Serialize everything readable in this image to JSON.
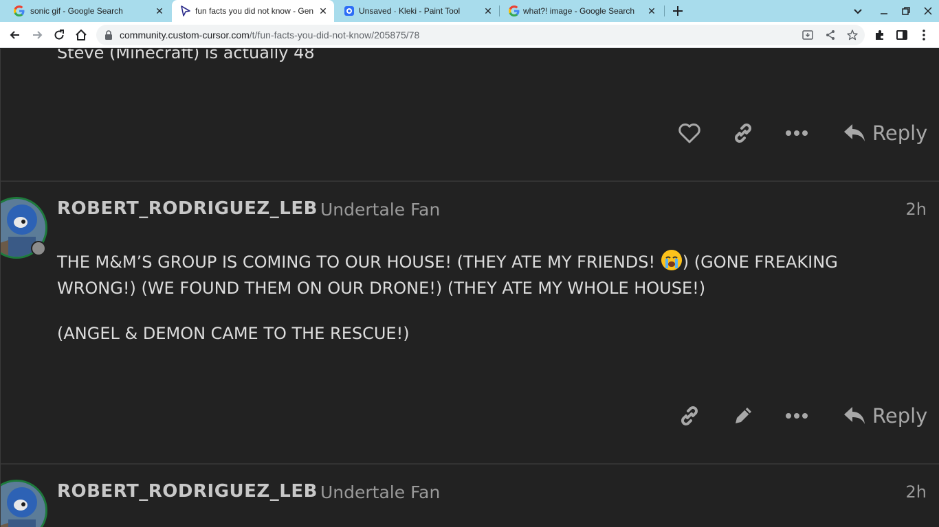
{
  "browser": {
    "tabs": [
      {
        "title": "sonic gif - Google Search",
        "favicon": "google-icon",
        "active": false
      },
      {
        "title": "fun facts you did not know - Gen",
        "favicon": "cursor-icon",
        "active": true
      },
      {
        "title": "Unsaved · Kleki - Paint Tool",
        "favicon": "kleki-icon",
        "active": false
      },
      {
        "title": "what?! image - Google Search",
        "favicon": "google-icon",
        "active": false
      }
    ],
    "url_host": "community.custom-cursor.com",
    "url_path": "/t/fun-facts-you-did-not-know/205875/78"
  },
  "previous_post": {
    "text": "Steve (Minecraft) is actually 48",
    "reply_label": "Reply"
  },
  "posts": [
    {
      "username": "ROBERT_RODRIGUEZ_LEB",
      "user_title": "Undertale Fan",
      "time": "2h",
      "para1_a": "THE M&M’S GROUP IS COMING TO OUR HOUSE! (THEY ATE MY FRIENDS! ",
      "emoji": "loudly-crying-face-emoji",
      "para1_b": ") (GONE FREAKING WRONG!) (WE FOUND THEM ON OUR DRONE!) (THEY ATE MY WHOLE HOUSE!)",
      "para2": "(ANGEL & DEMON CAME TO THE RESCUE!)",
      "reply_label": "Reply"
    },
    {
      "username": "ROBERT_RODRIGUEZ_LEB",
      "user_title": "Undertale Fan",
      "time": "2h"
    }
  ],
  "colors": {
    "tabstrip": "#a8dcec",
    "page_bg": "#222222",
    "avatar_ring": "#1e7a3c"
  }
}
